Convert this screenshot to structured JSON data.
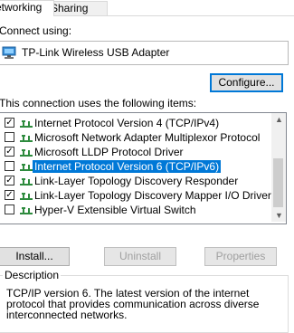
{
  "tabs": [
    {
      "label": "etworking"
    },
    {
      "label": "Sharing"
    }
  ],
  "connect_using": {
    "label": "Connect using:",
    "adapter": "TP-Link Wireless USB Adapter",
    "adapter_icon": "network-adapter-icon"
  },
  "buttons": {
    "configure": "Configure...",
    "install": "Install...",
    "uninstall": "Uninstall",
    "properties": "Properties"
  },
  "items_label": "This connection uses the following items:",
  "items": [
    {
      "label": "Internet Protocol Version 4 (TCP/IPv4)",
      "checked": true,
      "selected": false
    },
    {
      "label": "Microsoft Network Adapter Multiplexor Protocol",
      "checked": false,
      "selected": false
    },
    {
      "label": "Microsoft LLDP Protocol Driver",
      "checked": true,
      "selected": false
    },
    {
      "label": "Internet Protocol Version 6 (TCP/IPv6)",
      "checked": false,
      "selected": true
    },
    {
      "label": "Link-Layer Topology Discovery Responder",
      "checked": true,
      "selected": false
    },
    {
      "label": "Link-Layer Topology Discovery Mapper I/O Driver",
      "checked": true,
      "selected": false
    },
    {
      "label": "Hyper-V Extensible Virtual Switch",
      "checked": false,
      "selected": false
    }
  ],
  "description": {
    "title": "Description",
    "text": "TCP/IP version 6. The latest version of the internet protocol that provides communication across diverse interconnected networks."
  },
  "colors": {
    "selection": "#0078d7",
    "protocol_icon": "#2e8b3e"
  }
}
